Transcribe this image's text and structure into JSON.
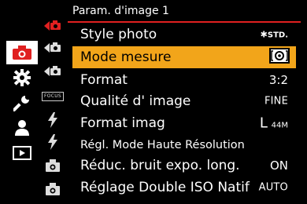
{
  "header": {
    "title": "Param. d'image 1"
  },
  "main_nav": [
    {
      "icon": "camera-icon",
      "active": true
    },
    {
      "icon": "gear-icon",
      "active": false
    },
    {
      "icon": "wrench-icon",
      "active": false
    },
    {
      "icon": "person-icon",
      "active": false
    },
    {
      "icon": "playback-icon",
      "active": false
    }
  ],
  "sub_nav": [
    {
      "icon": "camera-page-1-icon",
      "active": true
    },
    {
      "icon": "camera-page-2-icon",
      "active": false
    },
    {
      "icon": "camera-page-3-icon",
      "active": false
    },
    {
      "icon": "focus-icon",
      "label": "FOCUS"
    },
    {
      "icon": "flash-icon"
    },
    {
      "icon": "flash-icon"
    },
    {
      "icon": "camera-body-icon"
    },
    {
      "icon": "camera-body-icon"
    }
  ],
  "menu": {
    "selected_index": 1,
    "items": [
      {
        "label": "Style photo",
        "value": "STD.",
        "value_icon": "photo-style-standard-icon"
      },
      {
        "label": "Mode mesure",
        "value": "",
        "value_icon": "multi-metering-icon"
      },
      {
        "label": "Format",
        "value": "3:2"
      },
      {
        "label": "Qualité d' image",
        "value": "FINE"
      },
      {
        "label": "Format imag",
        "value": "L",
        "value_sub": "44M"
      },
      {
        "label": "Régl. Mode Haute Résolution",
        "value": ""
      },
      {
        "label": "Réduc. bruit expo. long.",
        "value": "ON"
      },
      {
        "label": "Réglage Double ISO Natif",
        "value": "AUTO"
      }
    ]
  },
  "colors": {
    "accent_red": "#e02020",
    "highlight": "#f2a51a",
    "background": "#000000"
  }
}
